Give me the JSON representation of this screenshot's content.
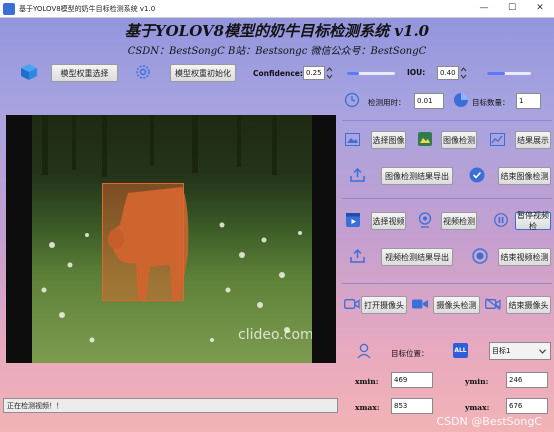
{
  "window": {
    "title": "基于YOLOV8模型的奶牛目标检测系统 v1.0",
    "min": "—",
    "max": "☐",
    "close": "✕"
  },
  "header": {
    "title": "基于YOLOV8模型的奶牛目标检测系统 v1.0",
    "subtitle": "CSDN：BestSongC   B站：Bestsongc   微信公众号：BestSongC"
  },
  "toolbar": {
    "select_weight": "模型权重选择",
    "init_weight": "模型权重初始化",
    "confidence_label": "Confidence:",
    "confidence_value": "0.25",
    "confidence_level": 0.25,
    "iou_label": "IOU:",
    "iou_value": "0.40",
    "iou_level": 0.4
  },
  "stats": {
    "time_label": "检测用时：",
    "time_value": "0.01",
    "count_label": "目标数量：",
    "count_value": "1"
  },
  "image_section": {
    "select_image": "选择图像",
    "detect_image": "图像检测",
    "show_result": "结果展示",
    "export_image": "图像检测结果导出",
    "end_image": "结束图像检测"
  },
  "video_section": {
    "select_video": "选择视频",
    "detect_video": "视频检测",
    "pause_video": "暂停视频检",
    "export_video": "视频检测结果导出",
    "end_video": "结束视频检测"
  },
  "camera_section": {
    "open_camera": "打开摄像头",
    "detect_camera": "摄像头检测",
    "end_camera": "结束摄像头"
  },
  "position": {
    "label": "目标位置：",
    "target_select": "目标1",
    "all_badge": "ALL",
    "xmin_label": "xmin:",
    "xmin": "469",
    "ymin_label": "ymin:",
    "ymin": "246",
    "xmax_label": "xmax:",
    "xmax": "853",
    "ymax_label": "ymax:",
    "ymax": "676"
  },
  "status": {
    "text": "正在检测视频！！"
  },
  "video": {
    "watermark": "clideo.com"
  },
  "footer": {
    "watermark": "CSDN @BestSongC"
  },
  "colors": {
    "accent": "#3a6fd8",
    "bbox": "#e8642e"
  }
}
